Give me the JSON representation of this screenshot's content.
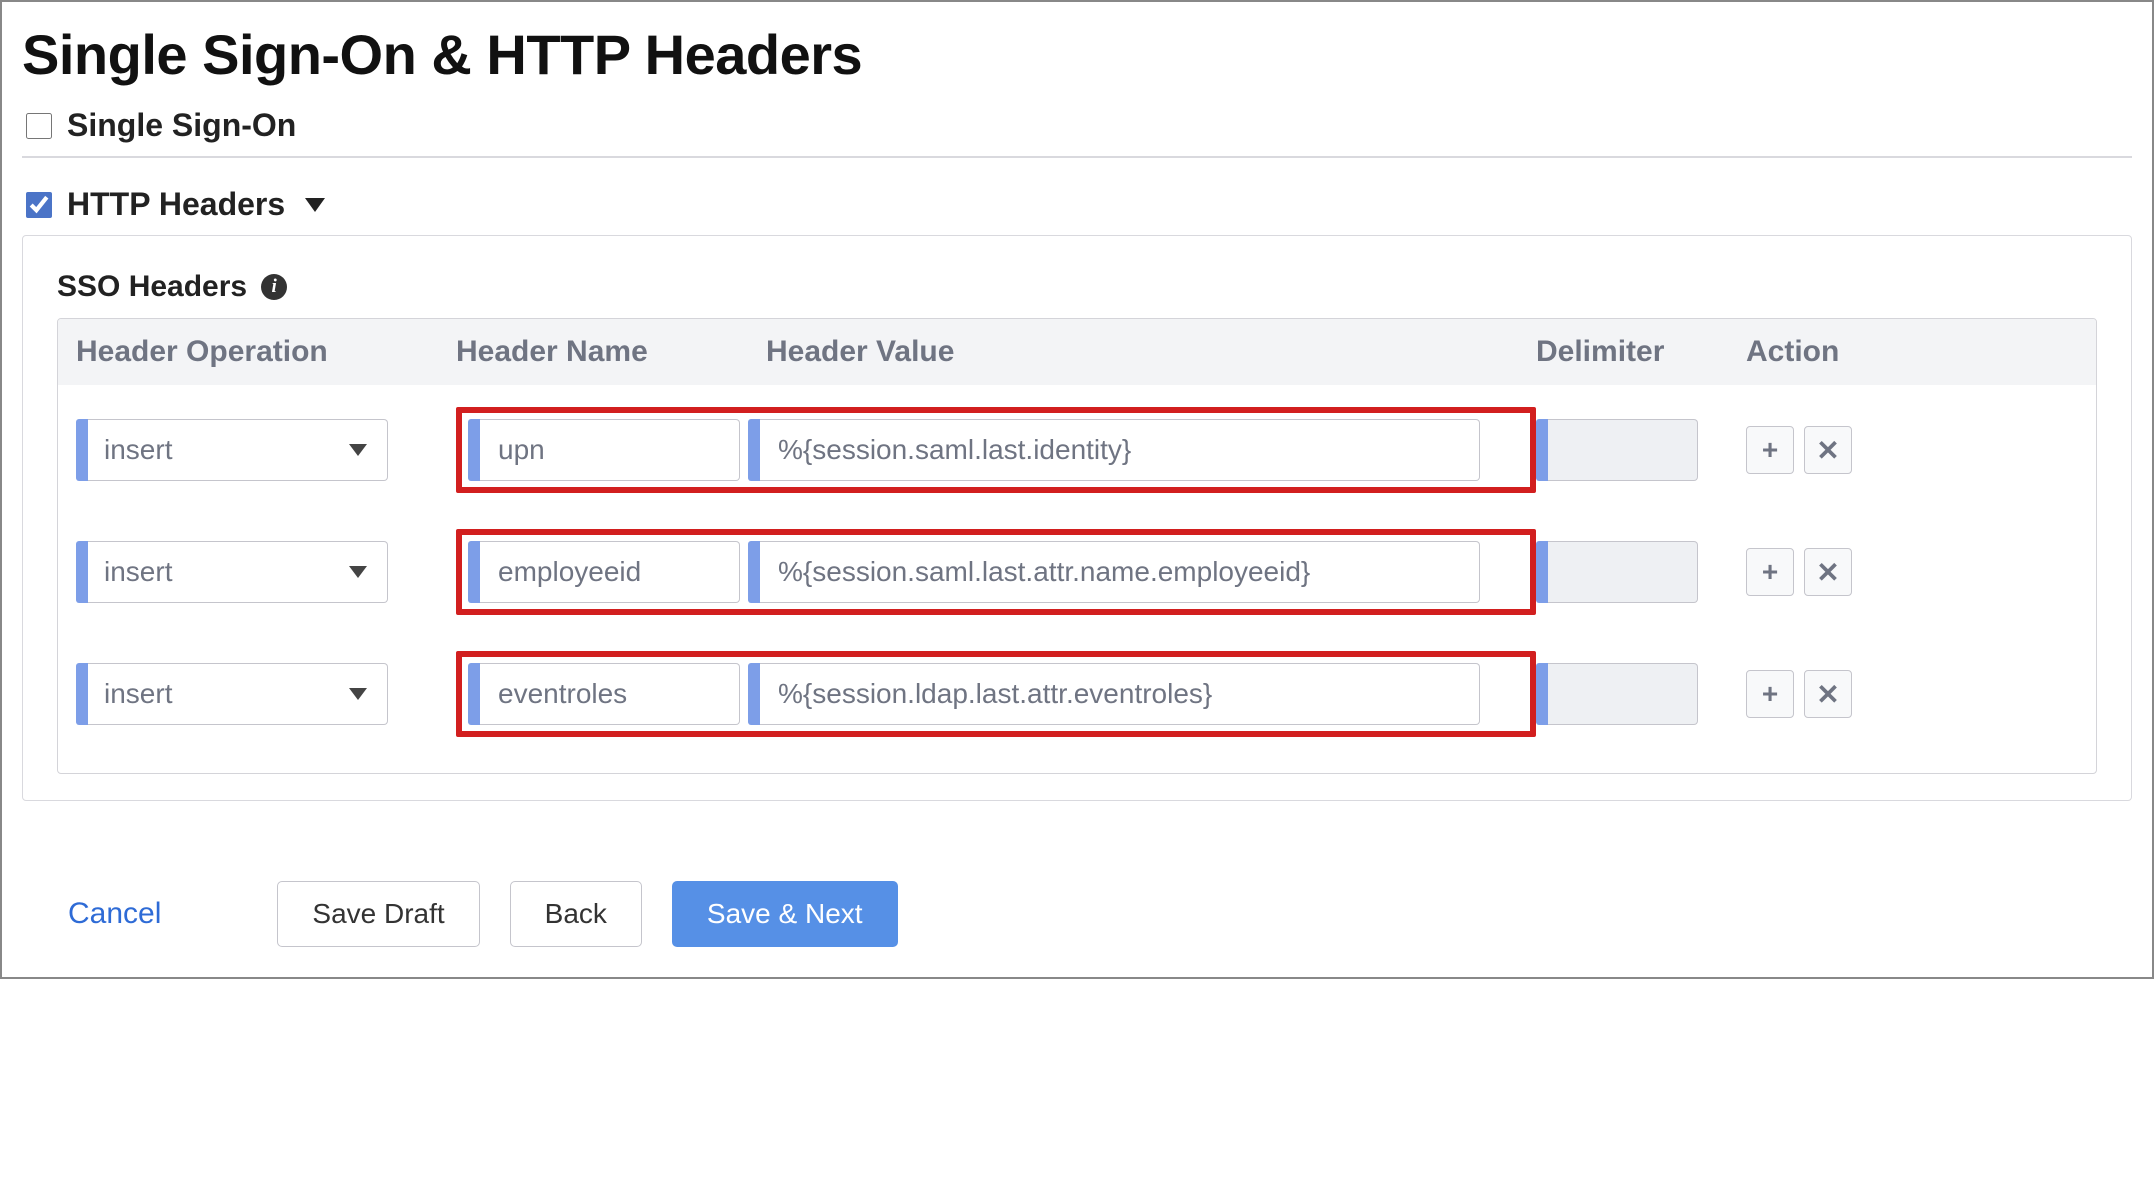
{
  "title": "Single Sign-On & HTTP Headers",
  "sso": {
    "label": "Single Sign-On",
    "checked": false
  },
  "http_headers": {
    "label": "HTTP Headers",
    "checked": true
  },
  "table": {
    "title": "SSO Headers",
    "columns": {
      "operation": "Header Operation",
      "name": "Header Name",
      "value": "Header Value",
      "delimiter": "Delimiter",
      "action": "Action"
    },
    "rows": [
      {
        "operation": "insert",
        "name": "upn",
        "value": "%{session.saml.last.identity}",
        "delimiter": ""
      },
      {
        "operation": "insert",
        "name": "employeeid",
        "value": "%{session.saml.last.attr.name.employeeid}",
        "delimiter": ""
      },
      {
        "operation": "insert",
        "name": "eventroles",
        "value": "%{session.ldap.last.attr.eventroles}",
        "delimiter": ""
      }
    ]
  },
  "footer": {
    "cancel": "Cancel",
    "save_draft": "Save Draft",
    "back": "Back",
    "save_next": "Save & Next"
  }
}
